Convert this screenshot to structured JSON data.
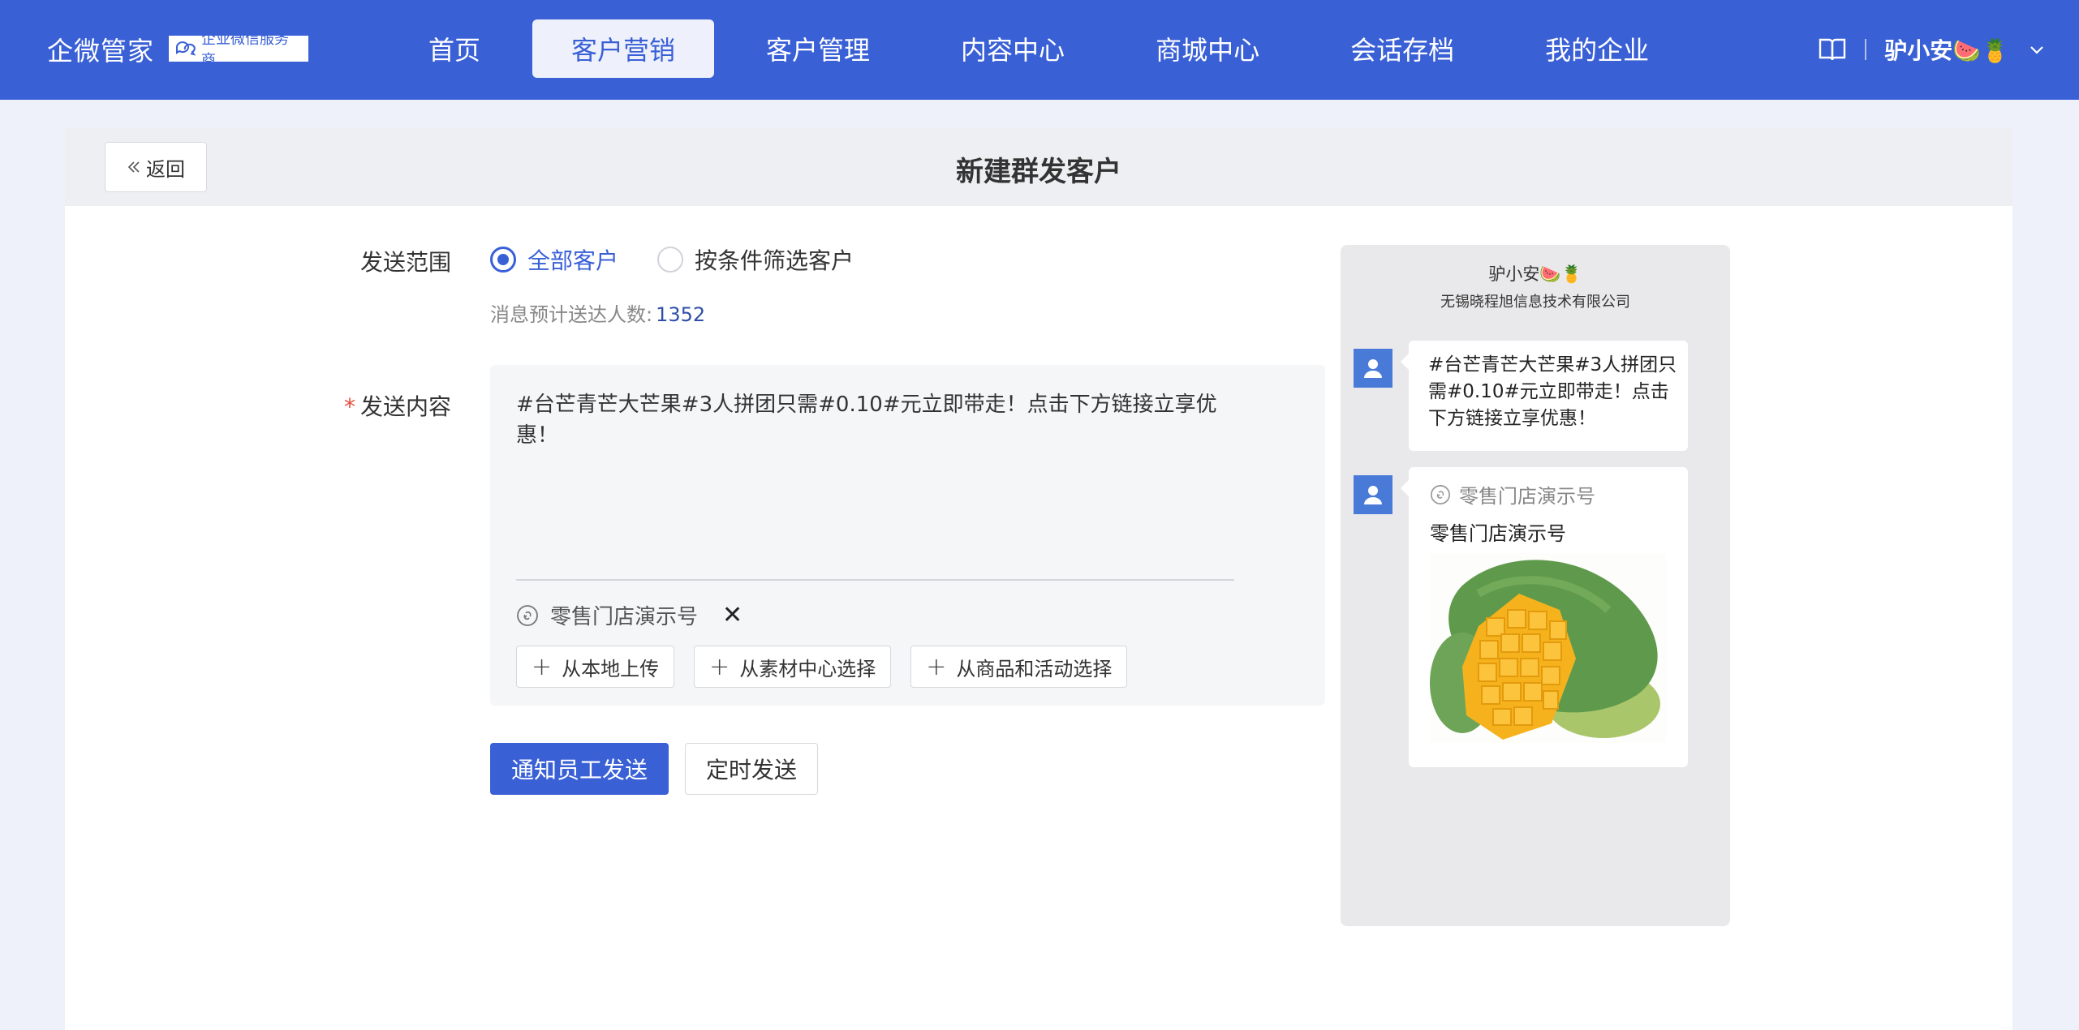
{
  "header": {
    "brand": "企微管家",
    "badge": "企业微信服务商",
    "nav": [
      {
        "label": "首页",
        "active": false
      },
      {
        "label": "客户营销",
        "active": true
      },
      {
        "label": "客户管理",
        "active": false
      },
      {
        "label": "内容中心",
        "active": false
      },
      {
        "label": "商城中心",
        "active": false
      },
      {
        "label": "会话存档",
        "active": false
      },
      {
        "label": "我的企业",
        "active": false
      }
    ],
    "user_name": "驴小安🍉🍍"
  },
  "page": {
    "back_label": "返回",
    "title": "新建群发客户"
  },
  "form": {
    "scope_label": "发送范围",
    "scope_options": [
      "全部客户",
      "按条件筛选客户"
    ],
    "scope_selected": "全部客户",
    "estimate_label": "消息预计送达人数:",
    "estimate_count": "1352",
    "content_label": "发送内容",
    "content_text": "#台芒青芒大芒果#3人拼团只需#0.10#元立即带走！点击下方链接立享优惠！",
    "attachment_name": "零售门店演示号",
    "attachment_close": "✕",
    "upload_buttons": [
      "从本地上传",
      "从素材中心选择",
      "从商品和活动选择"
    ],
    "primary_action": "通知员工发送",
    "secondary_action": "定时发送"
  },
  "preview": {
    "name": "驴小安🍉🍍",
    "company": "无锡晓程旭信息技术有限公司",
    "message_text": "#台芒青芒大芒果#3人拼团只需#0.10#元立即带走！点击下方链接立享优惠！",
    "miniapp_source": "零售门店演示号",
    "miniapp_title": "零售门店演示号"
  },
  "colors": {
    "primary": "#3a60d6",
    "header_bg": "#3a60d6",
    "page_bg": "#eef0fa",
    "required": "#e74c3c"
  }
}
